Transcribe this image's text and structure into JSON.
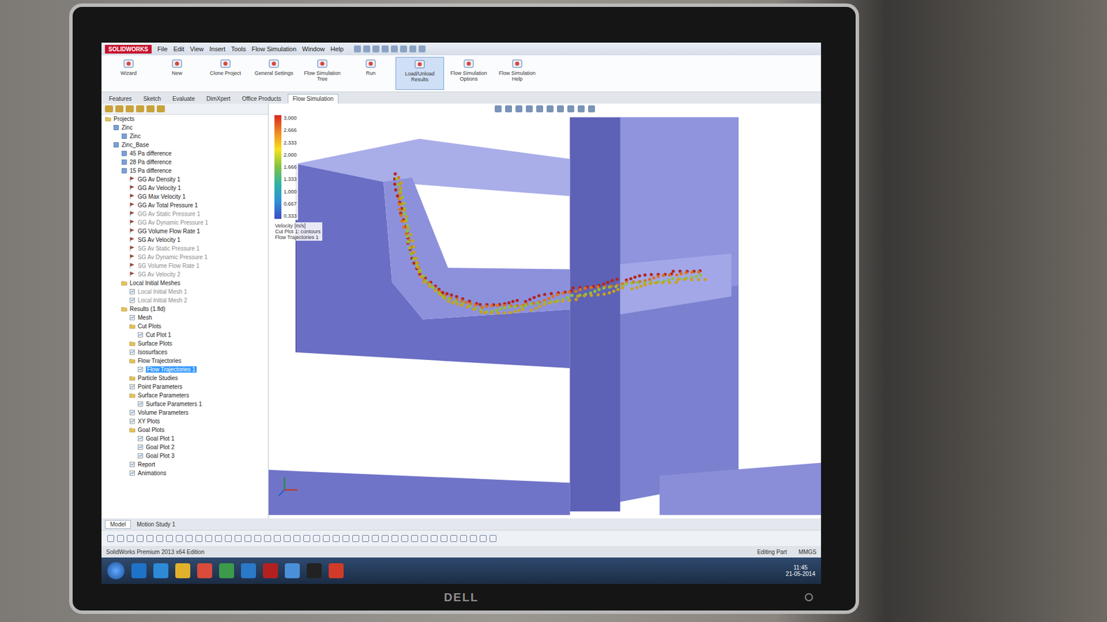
{
  "app": {
    "logo": "SOLIDWORKS"
  },
  "menu": [
    "File",
    "Edit",
    "View",
    "Insert",
    "Tools",
    "Flow Simulation",
    "Window",
    "Help"
  ],
  "ribbon_buttons": [
    {
      "label": "Wizard",
      "selected": false
    },
    {
      "label": "New",
      "selected": false
    },
    {
      "label": "Clone Project",
      "selected": false
    },
    {
      "label": "General Settings",
      "selected": false
    },
    {
      "label": "Flow Simulation Tree",
      "selected": false
    },
    {
      "label": "Run",
      "selected": false
    },
    {
      "label": "Load/Unload Results",
      "selected": true
    },
    {
      "label": "Flow Simulation Options",
      "selected": false
    },
    {
      "label": "Flow Simulation Help",
      "selected": false
    }
  ],
  "tabs": [
    {
      "label": "Features",
      "selected": false
    },
    {
      "label": "Sketch",
      "selected": false
    },
    {
      "label": "Evaluate",
      "selected": false
    },
    {
      "label": "DimXpert",
      "selected": false
    },
    {
      "label": "Office Products",
      "selected": false
    },
    {
      "label": "Flow Simulation",
      "selected": true
    }
  ],
  "tree": [
    {
      "label": "Projects",
      "depth": 0,
      "kind": "folder",
      "greyed": false,
      "selected": false
    },
    {
      "label": "Zinc",
      "depth": 1,
      "kind": "project",
      "greyed": false,
      "selected": false
    },
    {
      "label": "Zinc",
      "depth": 2,
      "kind": "project",
      "greyed": false,
      "selected": false
    },
    {
      "label": "Zinc_Base",
      "depth": 1,
      "kind": "project",
      "greyed": false,
      "selected": false
    },
    {
      "label": "45 Pa difference",
      "depth": 2,
      "kind": "project",
      "greyed": false,
      "selected": false
    },
    {
      "label": "28 Pa difference",
      "depth": 2,
      "kind": "project",
      "greyed": false,
      "selected": false
    },
    {
      "label": "15 Pa difference",
      "depth": 2,
      "kind": "project",
      "greyed": false,
      "selected": false
    },
    {
      "label": "GG Av Density 1",
      "depth": 3,
      "kind": "goal",
      "greyed": false,
      "selected": false
    },
    {
      "label": "GG Av Velocity 1",
      "depth": 3,
      "kind": "goal",
      "greyed": false,
      "selected": false
    },
    {
      "label": "GG Max Velocity 1",
      "depth": 3,
      "kind": "goal",
      "greyed": false,
      "selected": false
    },
    {
      "label": "GG Av Total Pressure 1",
      "depth": 3,
      "kind": "goal",
      "greyed": false,
      "selected": false
    },
    {
      "label": "GG Av Static Pressure 1",
      "depth": 3,
      "kind": "goal",
      "greyed": true,
      "selected": false
    },
    {
      "label": "GG Av Dynamic Pressure 1",
      "depth": 3,
      "kind": "goal",
      "greyed": true,
      "selected": false
    },
    {
      "label": "GG Volume Flow Rate 1",
      "depth": 3,
      "kind": "goal",
      "greyed": false,
      "selected": false
    },
    {
      "label": "SG Av Velocity 1",
      "depth": 3,
      "kind": "goal",
      "greyed": false,
      "selected": false
    },
    {
      "label": "SG Av Static Pressure 1",
      "depth": 3,
      "kind": "goal",
      "greyed": true,
      "selected": false
    },
    {
      "label": "SG Av Dynamic Pressure 1",
      "depth": 3,
      "kind": "goal",
      "greyed": true,
      "selected": false
    },
    {
      "label": "SG Volume Flow Rate 1",
      "depth": 3,
      "kind": "goal",
      "greyed": true,
      "selected": false
    },
    {
      "label": "SG Av Velocity 2",
      "depth": 3,
      "kind": "goal",
      "greyed": true,
      "selected": false
    },
    {
      "label": "Local Initial Meshes",
      "depth": 2,
      "kind": "folder",
      "greyed": false,
      "selected": false
    },
    {
      "label": "Local Initial Mesh 1",
      "depth": 3,
      "kind": "plot",
      "greyed": true,
      "selected": false
    },
    {
      "label": "Local Initial Mesh 2",
      "depth": 3,
      "kind": "plot",
      "greyed": true,
      "selected": false
    },
    {
      "label": "Results (1.fld)",
      "depth": 2,
      "kind": "folder",
      "greyed": false,
      "selected": false
    },
    {
      "label": "Mesh",
      "depth": 3,
      "kind": "plot",
      "greyed": false,
      "selected": false
    },
    {
      "label": "Cut Plots",
      "depth": 3,
      "kind": "folder",
      "greyed": false,
      "selected": false
    },
    {
      "label": "Cut Plot 1",
      "depth": 4,
      "kind": "plot",
      "greyed": false,
      "selected": false
    },
    {
      "label": "Surface Plots",
      "depth": 3,
      "kind": "folder",
      "greyed": false,
      "selected": false
    },
    {
      "label": "Isosurfaces",
      "depth": 3,
      "kind": "plot",
      "greyed": false,
      "selected": false
    },
    {
      "label": "Flow Trajectories",
      "depth": 3,
      "kind": "folder",
      "greyed": false,
      "selected": false
    },
    {
      "label": "Flow Trajectories 1",
      "depth": 4,
      "kind": "plot",
      "greyed": false,
      "selected": true
    },
    {
      "label": "Particle Studies",
      "depth": 3,
      "kind": "folder",
      "greyed": false,
      "selected": false
    },
    {
      "label": "Point Parameters",
      "depth": 3,
      "kind": "plot",
      "greyed": false,
      "selected": false
    },
    {
      "label": "Surface Parameters",
      "depth": 3,
      "kind": "folder",
      "greyed": false,
      "selected": false
    },
    {
      "label": "Surface Parameters 1",
      "depth": 4,
      "kind": "plot",
      "greyed": false,
      "selected": false
    },
    {
      "label": "Volume Parameters",
      "depth": 3,
      "kind": "plot",
      "greyed": false,
      "selected": false
    },
    {
      "label": "XY Plots",
      "depth": 3,
      "kind": "plot",
      "greyed": false,
      "selected": false
    },
    {
      "label": "Goal Plots",
      "depth": 3,
      "kind": "folder",
      "greyed": false,
      "selected": false
    },
    {
      "label": "Goal Plot 1",
      "depth": 4,
      "kind": "plot",
      "greyed": false,
      "selected": false
    },
    {
      "label": "Goal Plot 2",
      "depth": 4,
      "kind": "plot",
      "greyed": false,
      "selected": false
    },
    {
      "label": "Goal Plot 3",
      "depth": 4,
      "kind": "plot",
      "greyed": false,
      "selected": false
    },
    {
      "label": "Report",
      "depth": 3,
      "kind": "plot",
      "greyed": false,
      "selected": false
    },
    {
      "label": "Animations",
      "depth": 3,
      "kind": "plot",
      "greyed": false,
      "selected": false
    }
  ],
  "legend": {
    "ticks": [
      "3.000",
      "2.666",
      "2.333",
      "2.000",
      "1.666",
      "1.333",
      "1.000",
      "0.667",
      "0.333"
    ],
    "unit": "Velocity [m/s]",
    "captions": [
      "Cut Plot 1: contours",
      "Flow Trajectories 1"
    ],
    "colors": [
      "#d7261e",
      "#f08a24",
      "#f6e21a",
      "#7cc242",
      "#2bb3a3",
      "#2f8fd8",
      "#3a4bc4"
    ]
  },
  "trajectories": [
    {
      "color": "#b3261e"
    },
    {
      "color": "#d9731f"
    },
    {
      "color": "#8fbf3a"
    },
    {
      "color": "#c8a21c"
    }
  ],
  "bottom_tabs": [
    {
      "label": "Model",
      "selected": true
    },
    {
      "label": "Motion Study 1",
      "selected": false
    }
  ],
  "status": {
    "left": "SolidWorks Premium 2013 x64 Edition",
    "right": [
      "Editing Part",
      "MMGS"
    ]
  },
  "taskbar": {
    "time": "11:45",
    "date": "21-05-2014",
    "apps": [
      {
        "color": "#1e73c8"
      },
      {
        "color": "#2c8ad6"
      },
      {
        "color": "#e1b12c"
      },
      {
        "color": "#d94b3a"
      },
      {
        "color": "#3c9b4b"
      },
      {
        "color": "#2a78c8"
      },
      {
        "color": "#b32020"
      },
      {
        "color": "#4a90d9"
      },
      {
        "color": "#222222"
      },
      {
        "color": "#d23a2a"
      }
    ]
  },
  "bezel": {
    "brand": "DELL"
  }
}
